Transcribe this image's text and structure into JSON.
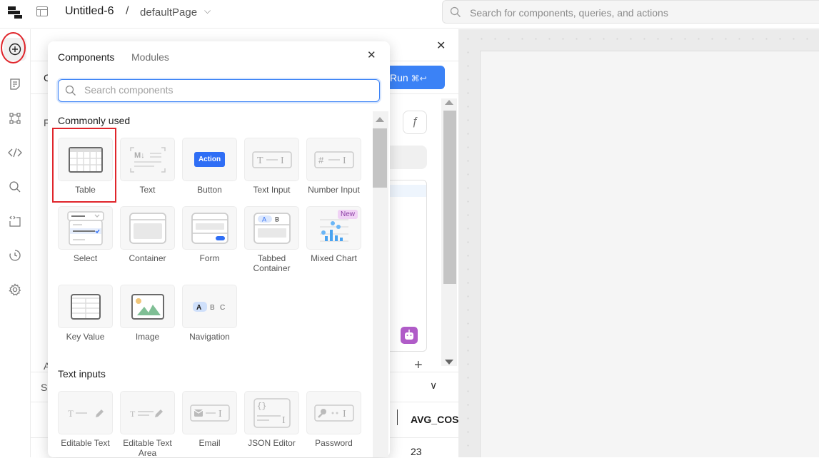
{
  "topbar": {
    "app_title": "Untitled-6",
    "separator": "/",
    "page_name": "defaultPage",
    "search_placeholder": "Search for components, queries, and actions"
  },
  "left_rail": {
    "items": [
      {
        "name": "add-component",
        "active": true
      },
      {
        "name": "pages"
      },
      {
        "name": "component-tree"
      },
      {
        "name": "code"
      },
      {
        "name": "search"
      },
      {
        "name": "state"
      },
      {
        "name": "history"
      },
      {
        "name": "settings"
      }
    ]
  },
  "code_panel": {
    "run_label": "Run",
    "run_shortcut": "⌘↩",
    "fx_label": "ƒ",
    "column_header": "AVG_COS",
    "cell_value": "23",
    "partial_letters": [
      "C",
      "F",
      "A",
      "S"
    ]
  },
  "popover": {
    "tabs": [
      {
        "label": "Components",
        "active": true
      },
      {
        "label": "Modules",
        "active": false
      }
    ],
    "search_placeholder": "Search components",
    "search_value": "",
    "sections": [
      {
        "title": "Commonly used",
        "items": [
          {
            "label": "Table",
            "highlighted": true
          },
          {
            "label": "Text"
          },
          {
            "label": "Button",
            "icon_text": "Action"
          },
          {
            "label": "Text Input"
          },
          {
            "label": "Number Input"
          },
          {
            "label": "Select"
          },
          {
            "label": "Container"
          },
          {
            "label": "Form"
          },
          {
            "label": "Tabbed Container",
            "icon_text": "A B"
          },
          {
            "label": "Mixed Chart",
            "badge": "New"
          },
          {
            "label": "Key Value"
          },
          {
            "label": "Image"
          },
          {
            "label": "Navigation",
            "icon_text": "A B C"
          }
        ]
      },
      {
        "title": "Text inputs",
        "items": [
          {
            "label": "Editable Text"
          },
          {
            "label": "Editable Text Area"
          },
          {
            "label": "Email"
          },
          {
            "label": "JSON Editor"
          },
          {
            "label": "Password"
          }
        ]
      }
    ]
  },
  "colors": {
    "accent": "#3b82f6",
    "highlight_annotation": "#e0252b",
    "ai_purple": "#b05cc8",
    "new_badge_bg": "#f0d2f5",
    "new_badge_text": "#8a3ea3"
  }
}
